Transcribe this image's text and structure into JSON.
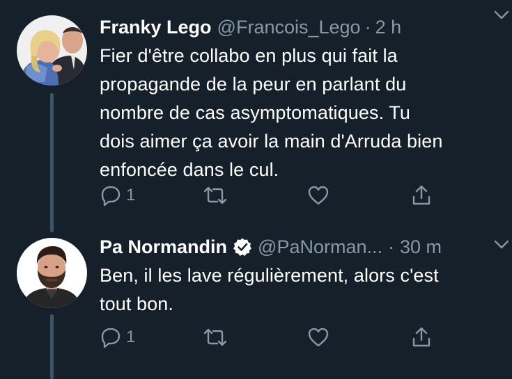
{
  "tweets": [
    {
      "display_name": "Franky Lego",
      "handle": "@Francois_Lego",
      "separator": "·",
      "time": "2 h",
      "verified": false,
      "avatar_icon": "avatar-couple-photo",
      "text_lines": [
        "Fier d'être collabo en plus qui fait la",
        "propagande de la peur en parlant du",
        "nombre de cas asymptomatiques. Tu",
        "dois aimer ça avoir la main d'Arruda bien",
        "enfoncée dans le cul."
      ],
      "reply_count": "1"
    },
    {
      "display_name": "Pa Normandin",
      "handle": "@PaNorman...",
      "separator": "·",
      "time": "30 m",
      "verified": true,
      "avatar_icon": "avatar-bearded-man-photo",
      "text_lines": [
        "Ben, il les lave régulièrement, alors c'est",
        "tout bon."
      ],
      "reply_count": "1"
    }
  ],
  "colors": {
    "background": "#15202b",
    "text_primary": "#ffffff",
    "text_secondary": "#8899a6",
    "thread_line": "#3d5466",
    "icon": "#8899a6"
  },
  "icons": {
    "reply": "reply-icon",
    "retweet": "retweet-icon",
    "like": "heart-icon",
    "share": "share-icon",
    "caret": "chevron-down-icon",
    "verified": "verified-badge-icon"
  }
}
